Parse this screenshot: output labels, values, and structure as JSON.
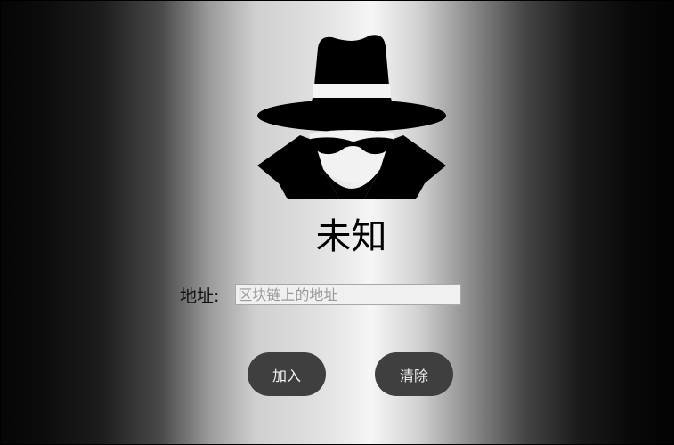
{
  "profile": {
    "avatar_icon": "incognito-spy-icon",
    "status_text": "未知"
  },
  "form": {
    "address_label": "地址:",
    "address_value": "",
    "address_placeholder": "区块链上的地址"
  },
  "actions": {
    "add_label": "加入",
    "clear_label": "清除"
  },
  "colors": {
    "button_bg": "#3f3f3f",
    "button_text": "#f2f2f2"
  }
}
